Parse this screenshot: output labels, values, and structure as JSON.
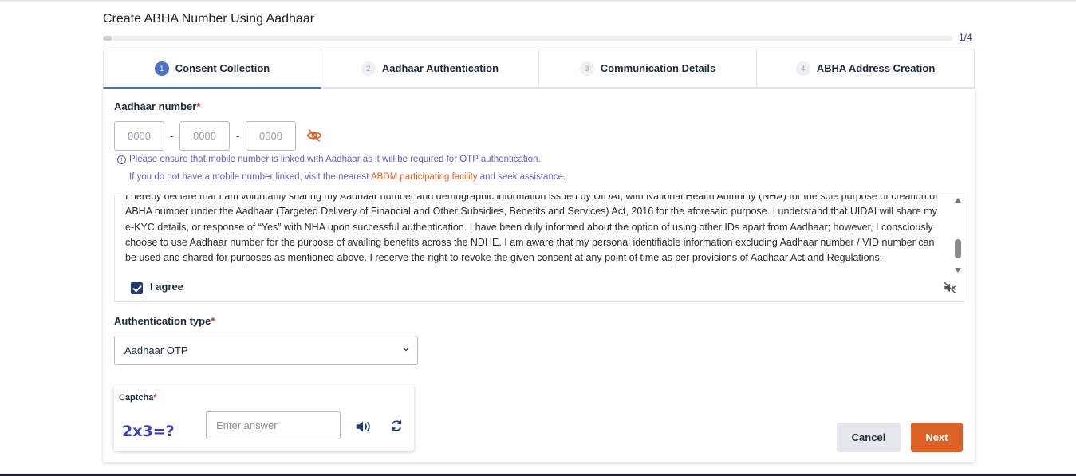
{
  "page": {
    "title": "Create ABHA Number Using Aadhaar"
  },
  "progress": {
    "text": "1/4",
    "value": 0.01
  },
  "tabs": [
    {
      "num": "1",
      "label": "Consent Collection",
      "active": true
    },
    {
      "num": "2",
      "label": "Aadhaar Authentication",
      "active": false
    },
    {
      "num": "3",
      "label": "Communication Details",
      "active": false
    },
    {
      "num": "4",
      "label": "ABHA Address Creation",
      "active": false
    }
  ],
  "aadhaar": {
    "label": "Aadhaar number",
    "required_mark": "*",
    "placeholders": [
      "0000",
      "0000",
      "0000"
    ],
    "separator": "-",
    "note_line1": "Please ensure that mobile number is linked with Aadhaar as it will be required for OTP authentication.",
    "note_line2_prefix": "If you do not have a mobile number linked, visit the nearest ",
    "note_line2_link": "ABDM participating facility",
    "note_line2_suffix": " and seek assistance."
  },
  "consent": {
    "text": "I hereby declare that I am voluntarily sharing my Aadhaar number and demographic information issued by UIDAI, with National Health Authority (NHA) for the sole purpose of creation of ABHA number under the Aadhaar (Targeted Delivery of Financial and Other Subsidies, Benefits and Services) Act, 2016 for the aforesaid purpose. I understand that UIDAI will share my e-KYC details, or response of “Yes” with NHA upon successful authentication. I have been duly informed about the option of using other IDs apart from Aadhaar; however, I consciously choose to use Aadhaar number for the purpose of availing benefits across the NDHE. I am aware that my personal identifiable information excluding Aadhaar number / VID number can be used and shared for purposes as mentioned above. I reserve the right to revoke the given consent at any point of time as per provisions of Aadhaar Act and Regulations.",
    "agree_label": "I agree",
    "agreed": true
  },
  "auth": {
    "label": "Authentication type",
    "required_mark": "*",
    "selected": "Aadhaar OTP"
  },
  "captcha": {
    "label": "Captcha",
    "required_mark": "*",
    "challenge": "2x3=?",
    "placeholder": "Enter answer"
  },
  "actions": {
    "cancel_label": "Cancel",
    "next_label": "Next"
  },
  "colors": {
    "primary": "#4f73c3",
    "navy": "#1f3b70",
    "accent": "#dc6126",
    "note": "#6b5bb7",
    "required": "#d32f2f"
  },
  "icons": {
    "eye": "eye-slash-icon",
    "mute": "speaker-mute-icon",
    "speaker": "speaker-icon",
    "refresh": "refresh-icon",
    "chevron": "chevron-down-icon",
    "info": "info-icon"
  }
}
